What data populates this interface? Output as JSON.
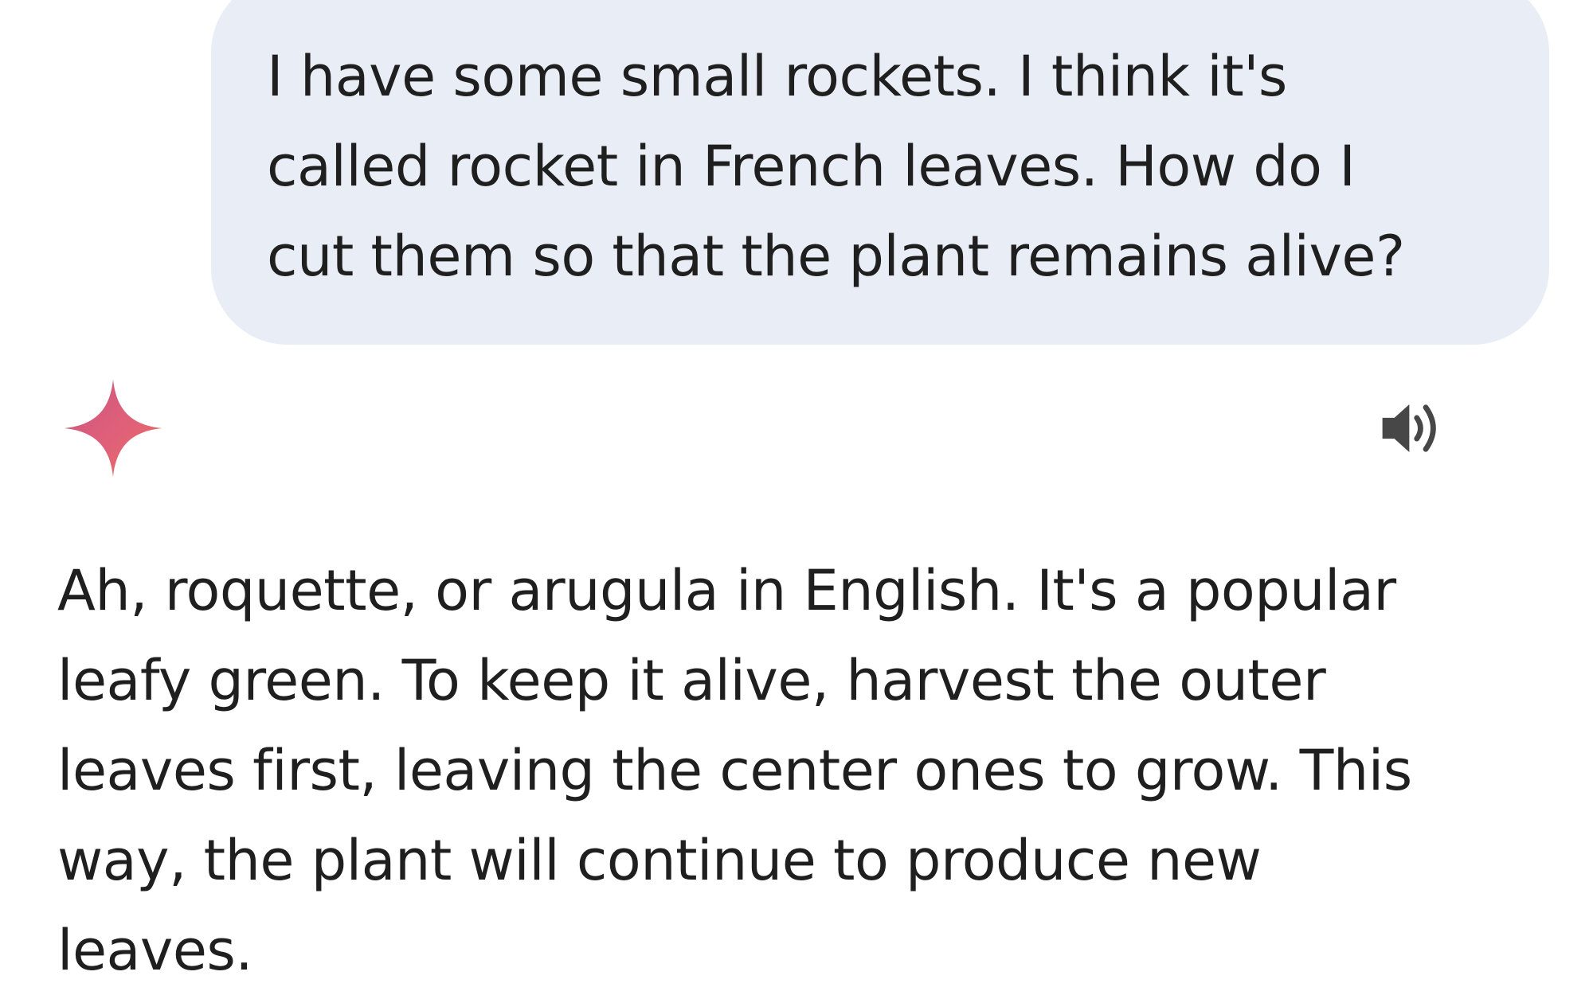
{
  "conversation": {
    "user_message": {
      "text": "I have some small rockets. I think it's\ncalled rocket in French leaves. How do I\ncut them so that the plant remains alive?",
      "bubble_color": "#e9edf6"
    },
    "assistant_message": {
      "icon": "gemini-spark-icon",
      "read_aloud_icon": "speaker-icon",
      "text": "Ah, roquette, or arugula in English. It's a popular\nleafy green. To keep it alive, harvest the outer\nleaves first, leaving the center ones to grow. This\nway, the plant will continue to produce new\nleaves."
    }
  },
  "colors": {
    "text": "#1f1f1f",
    "spark_gradient_start": "#d95a72",
    "spark_gradient_end": "#e36b5d",
    "speaker_icon": "#474747"
  }
}
